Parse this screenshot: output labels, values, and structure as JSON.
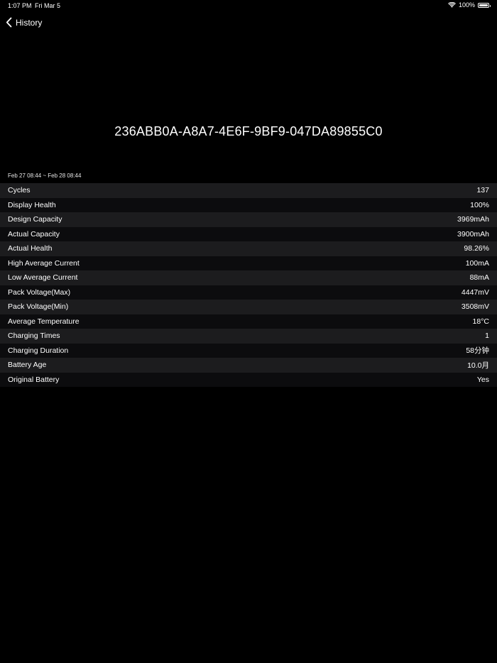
{
  "status_bar": {
    "time": "1:07 PM",
    "date": "Fri Mar 5",
    "battery_percent": "100%",
    "icons": [
      "wifi-icon",
      "battery-icon"
    ]
  },
  "nav": {
    "back_label": "History",
    "back_icon": "chevron-left-icon"
  },
  "device_id": "236ABB0A-A8A7-4E6F-9BF9-047DA89855C0",
  "date_range": "Feb 27 08:44 ~ Feb 28 08:44",
  "stats": [
    {
      "label": "Cycles",
      "value": "137"
    },
    {
      "label": "Display Health",
      "value": "100%"
    },
    {
      "label": "Design Capacity",
      "value": "3969mAh"
    },
    {
      "label": "Actual Capacity",
      "value": "3900mAh"
    },
    {
      "label": "Actual Health",
      "value": "98.26%"
    },
    {
      "label": "High Average Current",
      "value": "100mA"
    },
    {
      "label": "Low Average Current",
      "value": "88mA"
    },
    {
      "label": "Pack Voltage(Max)",
      "value": "4447mV"
    },
    {
      "label": "Pack Voltage(Min)",
      "value": "3508mV"
    },
    {
      "label": "Average Temperature",
      "value": "18°C"
    },
    {
      "label": "Charging Times",
      "value": "1"
    },
    {
      "label": "Charging Duration",
      "value": "58分钟"
    },
    {
      "label": "Battery Age",
      "value": "10.0月"
    },
    {
      "label": "Original Battery",
      "value": "Yes"
    }
  ],
  "colors": {
    "background": "#000000",
    "row_odd": "#1c1c1e",
    "row_even": "#0c0c0e",
    "text": "#ffffff"
  }
}
